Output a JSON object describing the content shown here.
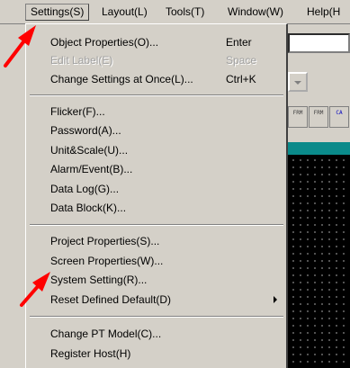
{
  "menubar": {
    "items": [
      {
        "label": "Settings(S)"
      },
      {
        "label": "Layout(L)"
      },
      {
        "label": "Tools(T)"
      },
      {
        "label": "Window(W)"
      },
      {
        "label": "Help(H"
      }
    ]
  },
  "menu": {
    "object_properties": {
      "label": "Object Properties(O)...",
      "shortcut": "Enter"
    },
    "edit_label": {
      "label": "Edit Label(E)",
      "shortcut": "Space"
    },
    "change_settings": {
      "label": "Change Settings at Once(L)...",
      "shortcut": "Ctrl+K"
    },
    "flicker": {
      "label": "Flicker(F)..."
    },
    "password": {
      "label": "Password(A)..."
    },
    "unit_scale": {
      "label": "Unit&Scale(U)..."
    },
    "alarm_event": {
      "label": "Alarm/Event(B)..."
    },
    "data_log": {
      "label": "Data Log(G)..."
    },
    "data_block": {
      "label": "Data Block(K)..."
    },
    "project_properties": {
      "label": "Project Properties(S)..."
    },
    "screen_properties": {
      "label": "Screen Properties(W)..."
    },
    "system_setting": {
      "label": "System Setting(R)..."
    },
    "reset_default": {
      "label": "Reset Defined Default(D)"
    },
    "change_pt_model": {
      "label": "Change PT Model(C)..."
    },
    "register_host": {
      "label": "Register Host(H)"
    }
  },
  "toolbar": {
    "buttons": [
      {
        "label": "FRM"
      },
      {
        "label": "FRM"
      },
      {
        "label": "CA"
      }
    ]
  },
  "colors": {
    "arrow": "#ff0000",
    "teal_bar": "#0a8a8a",
    "menu_bg": "#d4d0c8"
  }
}
